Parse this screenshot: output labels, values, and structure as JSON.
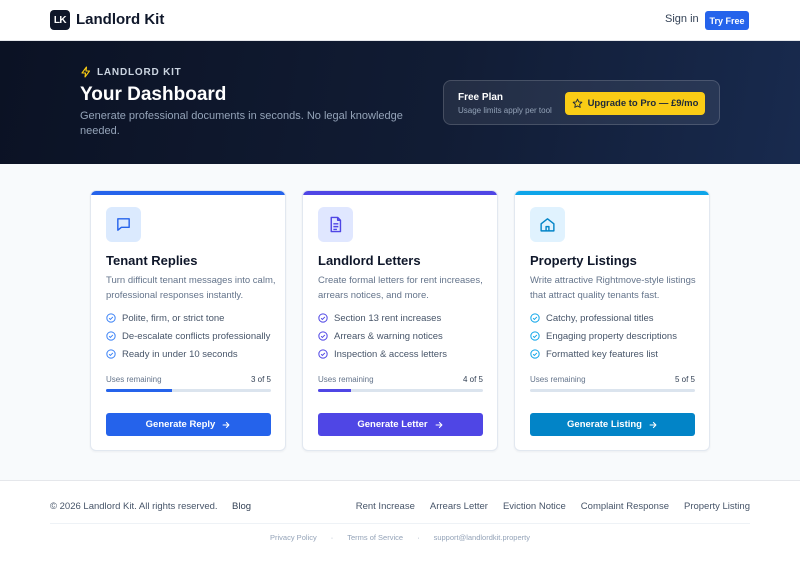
{
  "nav": {
    "logo_mark": "LK",
    "brand": "Landlord Kit",
    "signin": "Sign in",
    "try_free": "Try Free"
  },
  "hero": {
    "eyebrow": "LANDLORD KIT",
    "title": "Your Dashboard",
    "subtitle": "Generate professional documents in seconds. No legal knowledge needed.",
    "plan_name": "Free Plan",
    "plan_note": "Usage limits apply per tool",
    "upgrade_label": "Upgrade to Pro — £9/mo"
  },
  "cards": [
    {
      "title": "Tenant Replies",
      "description": "Turn difficult tenant messages into calm, professional responses instantly.",
      "features": [
        "Polite, firm, or strict tone",
        "De-escalate conflicts professionally",
        "Ready in under 10 seconds"
      ],
      "uses_label": "Uses remaining",
      "uses_count": "3 of 5",
      "uses_remaining_fraction": 0.4,
      "cta": "Generate Reply",
      "icon": "chat-icon",
      "accent": "#2563eb"
    },
    {
      "title": "Landlord Letters",
      "description": "Create formal letters for rent increases, arrears notices, and more.",
      "features": [
        "Section 13 rent increases",
        "Arrears & warning notices",
        "Inspection & access letters"
      ],
      "uses_label": "Uses remaining",
      "uses_count": "4 of 5",
      "uses_remaining_fraction": 0.2,
      "cta": "Generate Letter",
      "icon": "document-icon",
      "accent": "#4f46e5"
    },
    {
      "title": "Property Listings",
      "description": "Write attractive Rightmove-style listings that attract quality tenants fast.",
      "features": [
        "Catchy, professional titles",
        "Engaging property descriptions",
        "Formatted key features list"
      ],
      "uses_label": "Uses remaining",
      "uses_count": "5 of 5",
      "uses_remaining_fraction": 0.0,
      "cta": "Generate Listing",
      "icon": "home-icon",
      "accent": "#0284c7"
    }
  ],
  "footer": {
    "copyright": "© 2026 Landlord Kit. All rights reserved.",
    "blog": "Blog",
    "links": [
      "Rent Increase",
      "Arrears Letter",
      "Eviction Notice",
      "Complaint Response",
      "Property Listing"
    ],
    "privacy": "Privacy Policy",
    "sep": "·",
    "terms": "Terms of Service",
    "email": "support@landlordkit.property"
  },
  "colors": {
    "primary": "#2563eb",
    "indigo": "#4f46e5",
    "sky": "#0284c7",
    "hero_bg": "#0b1224",
    "upgrade": "#facc15",
    "check": "#3b82f6"
  }
}
